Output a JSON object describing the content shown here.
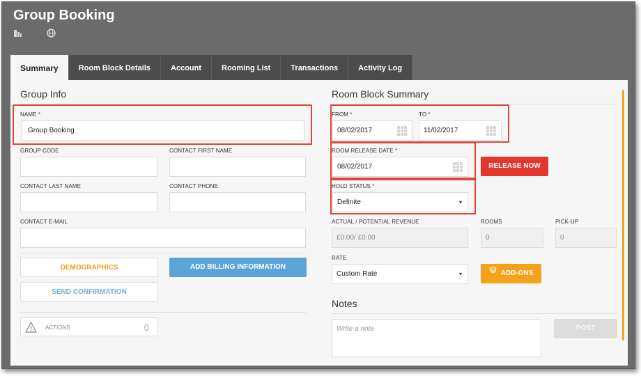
{
  "header": {
    "title": "Group Booking",
    "icons": [
      "building-icon",
      "globe-icon"
    ]
  },
  "tabs": [
    {
      "label": "Summary",
      "active": true
    },
    {
      "label": "Room Block Details",
      "active": false
    },
    {
      "label": "Account",
      "active": false
    },
    {
      "label": "Rooming List",
      "active": false
    },
    {
      "label": "Transactions",
      "active": false
    },
    {
      "label": "Activity Log",
      "active": false
    }
  ],
  "group_info": {
    "title": "Group Info",
    "name_label": "NAME",
    "name_value": "Group Booking",
    "group_code_label": "GROUP CODE",
    "contact_first_name_label": "CONTACT FIRST NAME",
    "contact_last_name_label": "CONTACT LAST NAME",
    "contact_phone_label": "CONTACT PHONE",
    "contact_email_label": "CONTACT E-MAIL",
    "demographics_label": "DEMOGRAPHICS",
    "add_billing_label": "ADD BILLING INFORMATION",
    "send_confirmation_label": "SEND CONFIRMATION",
    "actions_label": "ACTIONS",
    "actions_count": "0"
  },
  "room_block": {
    "title": "Room Block Summary",
    "from_label": "FROM",
    "from_value": "08/02/2017",
    "to_label": "TO",
    "to_value": "11/02/2017",
    "release_date_label": "ROOM RELEASE DATE",
    "release_date_value": "08/02/2017",
    "release_now_label": "RELEASE NOW",
    "hold_status_label": "HOLD STATUS",
    "hold_status_value": "Definite",
    "revenue_label": "ACTUAL / POTENTIAL REVENUE",
    "revenue_value": "£0.00/ £0.00",
    "rooms_label": "ROOMS",
    "rooms_value": "0",
    "pickup_label": "PICK-UP",
    "pickup_value": "0",
    "rate_label": "RATE",
    "rate_value": "Custom Rate",
    "addons_label": "ADD-ONS"
  },
  "notes": {
    "title": "Notes",
    "placeholder": "Write a note",
    "post_label": "POST"
  },
  "colors": {
    "highlight": "#d94a3a",
    "required": "#d0021b",
    "release_now": "#e2372c",
    "addons": "#f5a21b",
    "billing": "#5ba4d8",
    "demographics_text": "#f0a020",
    "send_confirmation_text": "#6fb2de"
  }
}
